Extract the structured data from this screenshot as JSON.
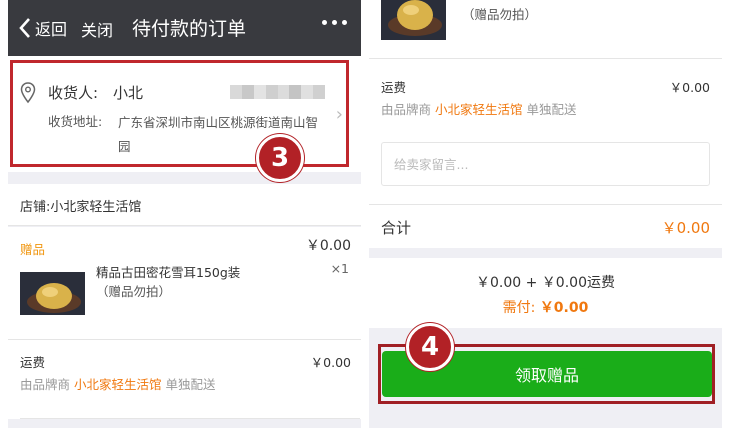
{
  "left": {
    "nav": {
      "back_label": "返回",
      "close_label": "关闭",
      "title": "待付款的订单"
    },
    "address": {
      "receiver_label": "收货人:",
      "receiver_name": "小北",
      "address_label": "收货地址:",
      "address_text": "广东省深圳市南山区桃源街道南山智园"
    },
    "step_badge": "3",
    "shop": {
      "label": "店铺:小北家轻生活馆"
    },
    "gift": {
      "tag": "赠品",
      "price": "￥0.00",
      "name": "精品古田密花雪耳150g装",
      "note": "（赠品勿拍）",
      "qty": "×1"
    },
    "shipping": {
      "label": "运费",
      "price": "￥0.00",
      "note_prefix": "由品牌商 ",
      "note_shop": "小北家轻生活馆",
      "note_suffix": " 单独配送"
    }
  },
  "right": {
    "gift_note": "（赠品勿拍）",
    "shipping": {
      "label": "运费",
      "price": "￥0.00",
      "note_prefix": "由品牌商 ",
      "note_shop": "小北家轻生活馆",
      "note_suffix": " 单独配送"
    },
    "message_placeholder": "给卖家留言...",
    "total": {
      "label": "合计",
      "value": "￥0.00"
    },
    "summary": {
      "line": "￥0.00 + ￥0.00运费",
      "pay_label": "需付: ",
      "pay_value": "￥0.00"
    },
    "step_badge": "4",
    "claim_button": "领取赠品"
  },
  "colors": {
    "navbar": "#393a3f",
    "accent_orange": "#f0780f",
    "gift_tag": "#f0960f",
    "highlight_red": "#c0272d",
    "button_green": "#1aad19"
  },
  "icons": [
    "back-chevron-icon",
    "more-dots-icon",
    "location-pin-icon",
    "chevron-right-icon"
  ]
}
